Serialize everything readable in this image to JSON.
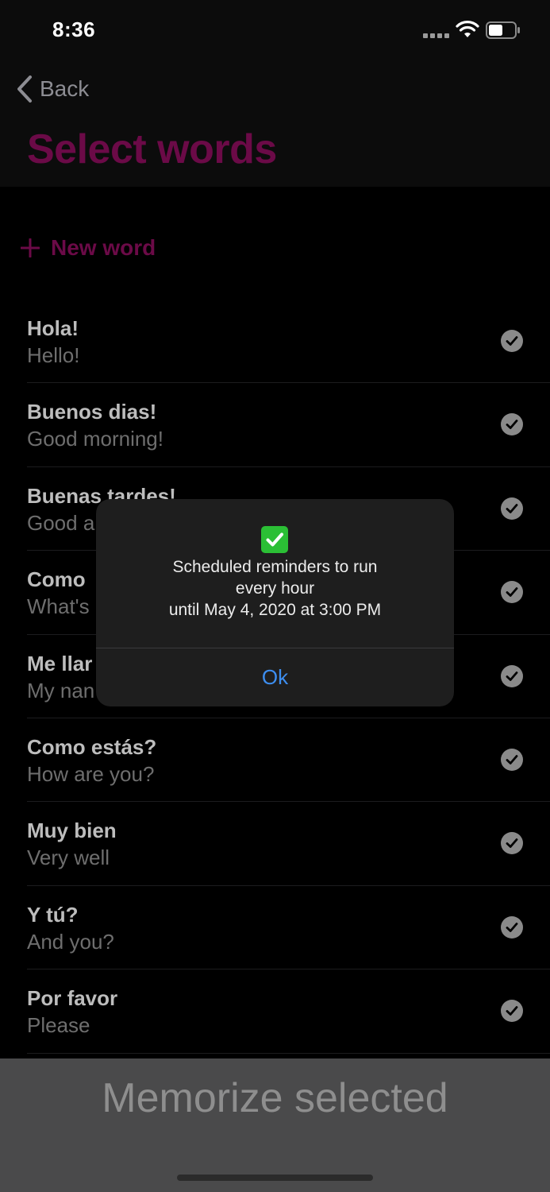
{
  "status_bar": {
    "time": "8:36"
  },
  "nav": {
    "back_label": "Back",
    "title": "Select words"
  },
  "actions": {
    "new_word_label": "New word"
  },
  "words": [
    {
      "word": "Hola!",
      "translation": "Hello!"
    },
    {
      "word": "Buenos dias!",
      "translation": "Good morning!"
    },
    {
      "word": "Buenas tardes!",
      "translation": "Good a"
    },
    {
      "word": "Como",
      "translation": "What's"
    },
    {
      "word": "Me llar",
      "translation": "My nan"
    },
    {
      "word": "Como estás?",
      "translation": "How are you?"
    },
    {
      "word": "Muy bien",
      "translation": "Very well"
    },
    {
      "word": "Y tú?",
      "translation": "And you?"
    },
    {
      "word": "Por favor",
      "translation": "Please"
    }
  ],
  "alert": {
    "icon": "check-mark-emoji-icon",
    "message_lines": [
      "Scheduled reminders to run",
      "every hour",
      "until May 4, 2020 at 3:00 PM"
    ],
    "ok_label": "Ok"
  },
  "bottom_bar": {
    "button_label": "Memorize selected"
  },
  "colors": {
    "accent": "#6b0a47",
    "alert_button": "#3d8ef0",
    "check_emoji": "#2bbf35"
  }
}
